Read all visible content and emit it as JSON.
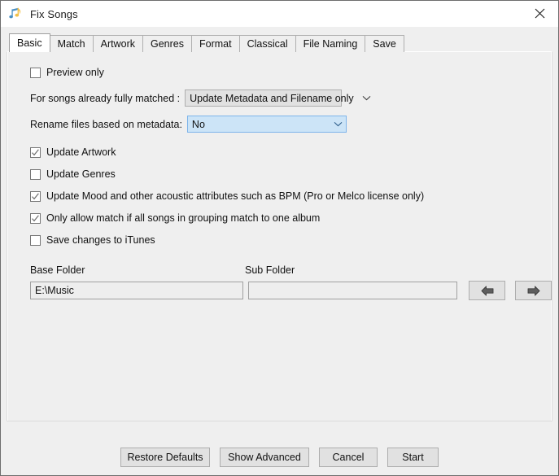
{
  "window": {
    "title": "Fix Songs",
    "icon": "music-note-icon",
    "close_label": "✕",
    "colors": {
      "titlebar_bg": "#ffffff",
      "dialog_bg": "#efefef",
      "frame_border": "#6d6d6d",
      "control_bg": "#e1e1e1",
      "control_border": "#adadad",
      "focus_bg": "#cce4f7",
      "focus_border": "#7eb4ea",
      "icon_note_blue": "#4a90c4",
      "icon_note_gold": "#f2c14b"
    }
  },
  "tabs": [
    {
      "label": "Basic",
      "active": true
    },
    {
      "label": "Match",
      "active": false
    },
    {
      "label": "Artwork",
      "active": false
    },
    {
      "label": "Genres",
      "active": false
    },
    {
      "label": "Format",
      "active": false
    },
    {
      "label": "Classical",
      "active": false
    },
    {
      "label": "File Naming",
      "active": false
    },
    {
      "label": "Save",
      "active": false
    }
  ],
  "basic": {
    "preview_only": {
      "label": "Preview only",
      "checked": false
    },
    "matched": {
      "label": "For songs already fully matched :",
      "value": "Update Metadata and Filename only",
      "focused": false
    },
    "rename": {
      "label": "Rename files based on metadata:",
      "value": "No",
      "focused": true
    },
    "checkboxes": [
      {
        "label": "Update Artwork",
        "checked": true
      },
      {
        "label": "Update Genres",
        "checked": false
      },
      {
        "label": "Update Mood and other acoustic attributes such as BPM (Pro or Melco license only)",
        "checked": true
      },
      {
        "label": "Only allow match if all songs in grouping match to one album",
        "checked": true
      },
      {
        "label": "Save changes to iTunes",
        "checked": false
      }
    ],
    "folders": {
      "base_heading": "Base Folder",
      "sub_heading": "Sub Folder",
      "base_value": "E:\\Music",
      "base_placeholder": "",
      "sub_value": "",
      "sub_placeholder": "",
      "back_icon": "arrow-left-icon",
      "forward_icon": "arrow-right-icon"
    }
  },
  "footer": {
    "restore_defaults": "Restore Defaults",
    "show_advanced": "Show Advanced",
    "cancel": "Cancel",
    "start": "Start"
  }
}
